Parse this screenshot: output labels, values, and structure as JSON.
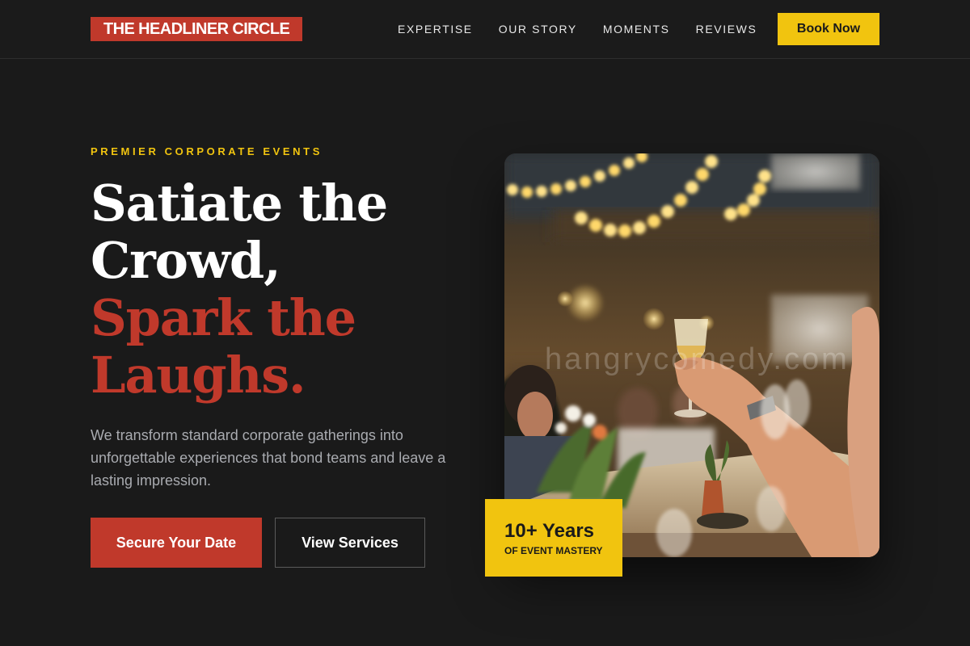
{
  "brand": {
    "logo_text": "THE HEADLINER CIRCLE"
  },
  "nav": {
    "links": [
      {
        "label": "EXPERTISE"
      },
      {
        "label": "OUR STORY"
      },
      {
        "label": "MOMENTS"
      },
      {
        "label": "REVIEWS"
      }
    ],
    "cta_label": "Book Now"
  },
  "hero": {
    "eyebrow": "PREMIER CORPORATE EVENTS",
    "headline_line1": "Satiate the",
    "headline_line2": "Crowd,",
    "headline_line3": "Spark the",
    "headline_line4": "Laughs.",
    "description": "We transform standard corporate gatherings into unforgettable experiences that bond teams and leave a lasting impression.",
    "primary_cta": "Secure Your Date",
    "secondary_cta": "View Services",
    "image_watermark": "hangrycomedy.com",
    "badge_value": "10+ Years",
    "badge_caption": "OF EVENT MASTERY"
  },
  "colors": {
    "background": "#1a1a1a",
    "accent_red": "#c0392b",
    "accent_yellow": "#f1c40f",
    "text_muted": "#a9abb0"
  }
}
